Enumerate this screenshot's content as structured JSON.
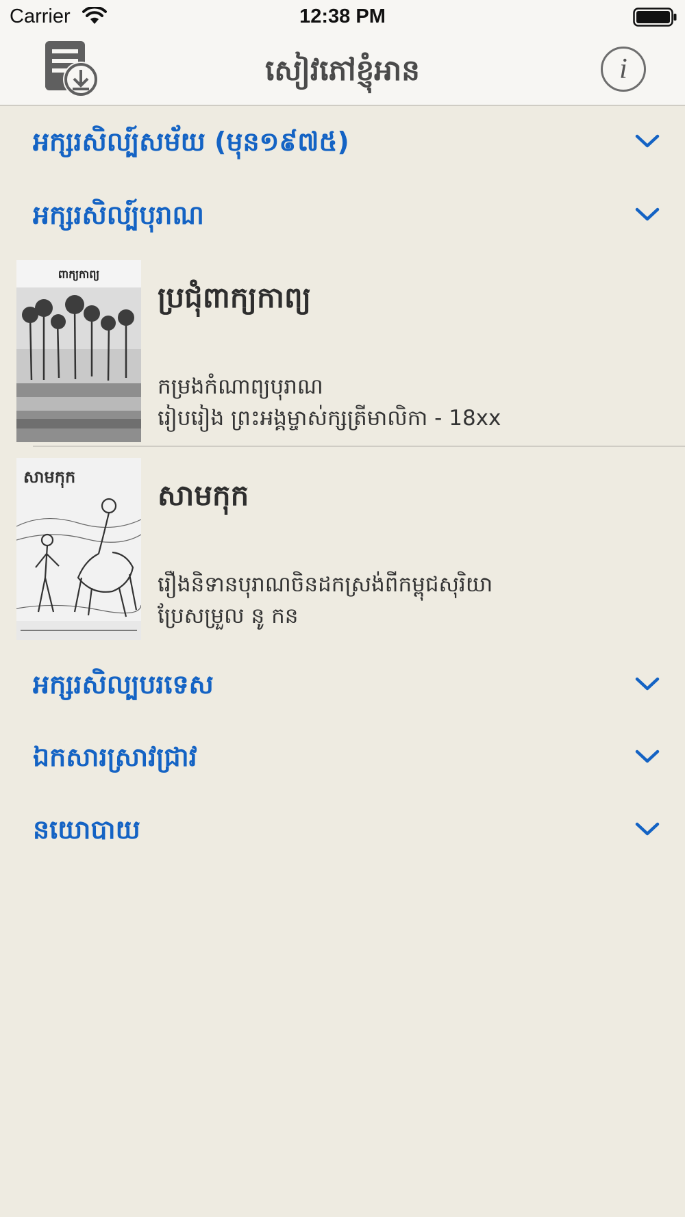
{
  "status_bar": {
    "carrier": "Carrier",
    "time": "12:38 PM",
    "icons": [
      "wifi-icon",
      "battery-icon"
    ]
  },
  "nav": {
    "title": "សៀវភៅខ្ញុំអាន",
    "left_icon": "download-document-icon",
    "right_icon": "info-icon",
    "info_glyph": "i"
  },
  "sections": [
    {
      "title": "អក្សរសិល្ប៍សម័យ (មុន១៩៧៥)",
      "icon": "chevron-down-icon"
    },
    {
      "title": "អក្សរសិល្ប៍បុរាណ",
      "icon": "chevron-down-icon"
    },
    {
      "title": "អក្សរសិល្បបរទេស",
      "icon": "chevron-down-icon"
    },
    {
      "title": "ឯកសារស្រាវជ្រាវ",
      "icon": "chevron-down-icon"
    },
    {
      "title": "នយោបាយ",
      "icon": "chevron-down-icon"
    }
  ],
  "books": [
    {
      "cover_title": "ពាក្យកាព្យ",
      "title": "ប្រជុំពាក្យកាព្យ",
      "description": "កម្រងកំណាព្យបុរាណ",
      "meta": "រៀបរៀង ព្រះអង្គម្ចាស់ក្សត្រីមាលិកា - 18xx"
    },
    {
      "cover_title": "សាមកុក",
      "title": "សាមកុក",
      "description": "រឿងនិទានបុរាណចិនដកស្រង់ពីកម្ពុជសុរិយា",
      "meta": "ប្រែសម្រួល នូ កន"
    }
  ],
  "colors": {
    "background": "#eeebe1",
    "bar": "#f7f6f3",
    "accent": "#1463c4",
    "title_text": "#4a4a4a"
  }
}
